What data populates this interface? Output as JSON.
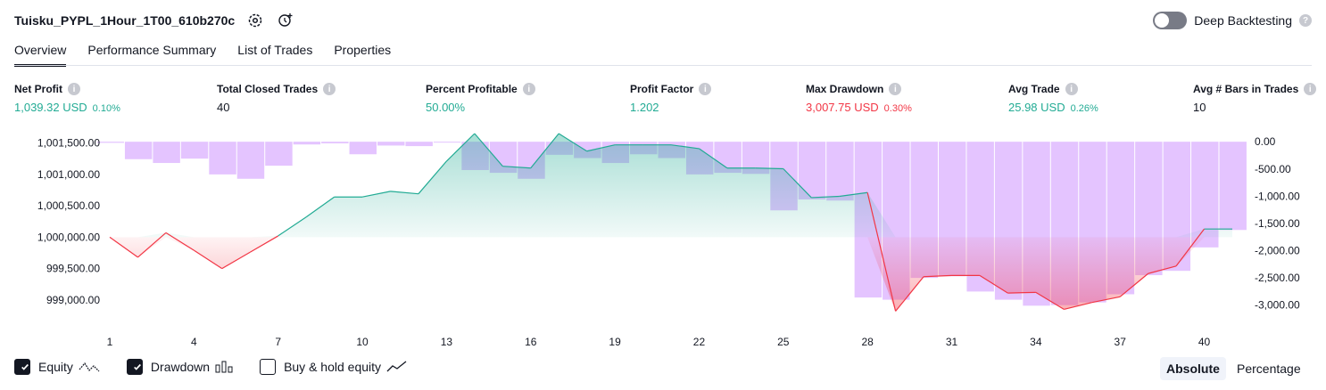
{
  "header": {
    "title": "Tuisku_PYPL_1Hour_1T00_610b270c",
    "deep_backtesting_label": "Deep Backtesting"
  },
  "tabs": [
    "Overview",
    "Performance Summary",
    "List of Trades",
    "Properties"
  ],
  "metrics": [
    {
      "label": "Net Profit",
      "value": "1,039.32 USD",
      "sub": "0.10%",
      "color": "#22ab94"
    },
    {
      "label": "Total Closed Trades",
      "value": "40",
      "sub": "",
      "color": "#131722"
    },
    {
      "label": "Percent Profitable",
      "value": "50.00%",
      "sub": "",
      "color": "#22ab94"
    },
    {
      "label": "Profit Factor",
      "value": "1.202",
      "sub": "",
      "color": "#22ab94"
    },
    {
      "label": "Max Drawdown",
      "value": "3,007.75 USD",
      "sub": "0.30%",
      "color": "#f23645"
    },
    {
      "label": "Avg Trade",
      "value": "25.98 USD",
      "sub": "0.26%",
      "color": "#22ab94"
    },
    {
      "label": "Avg # Bars in Trades",
      "value": "10",
      "sub": "",
      "color": "#131722"
    }
  ],
  "legend": {
    "equity": "Equity",
    "drawdown": "Drawdown",
    "buyhold": "Buy & hold equity"
  },
  "modes": {
    "absolute": "Absolute",
    "percentage": "Percentage"
  },
  "chart_data": {
    "type": "line",
    "x": [
      1,
      2,
      3,
      4,
      5,
      6,
      7,
      8,
      9,
      10,
      11,
      12,
      13,
      14,
      15,
      16,
      17,
      18,
      19,
      20,
      21,
      22,
      23,
      24,
      25,
      26,
      27,
      28,
      29,
      30,
      31,
      32,
      33,
      34,
      35,
      36,
      37,
      38,
      39,
      40,
      41
    ],
    "x_ticks": [
      "1",
      "4",
      "7",
      "10",
      "13",
      "16",
      "19",
      "22",
      "25",
      "28",
      "31",
      "34",
      "37",
      "40"
    ],
    "y_left_ticks": [
      "1,001,500.00",
      "1,001,000.00",
      "1,000,500.00",
      "1,000,000.00",
      "999,500.00",
      "999,000.00"
    ],
    "y_right_ticks": [
      "0.00",
      "-500.00",
      "-1,000.00",
      "-1,500.00",
      "-2,000.00",
      "-2,500.00",
      "-3,000.00"
    ],
    "ylim_left": [
      998700,
      1001650
    ],
    "ylim_right": [
      -3250,
      150
    ],
    "series": [
      {
        "name": "Equity",
        "values": [
          1000000,
          999680,
          1000070,
          999790,
          999500,
          999760,
          1000020,
          1000320,
          1000640,
          1000640,
          1000730,
          1000690,
          1001210,
          1001650,
          1001130,
          1001100,
          1001650,
          1001370,
          1001470,
          1001470,
          1001470,
          1001410,
          1001100,
          1001100,
          1001090,
          1000630,
          1000650,
          1000710,
          998820,
          999370,
          999390,
          999390,
          999110,
          999120,
          998850,
          998960,
          999050,
          999420,
          999540,
          1000130,
          1000130
        ],
        "color": "#22ab94"
      },
      {
        "name": "Drawdown",
        "values": [
          -20,
          -320,
          -390,
          -310,
          -600,
          -680,
          -440,
          -50,
          -30,
          -230,
          -70,
          -80,
          0,
          -520,
          -570,
          -680,
          -240,
          -300,
          -390,
          -230,
          -300,
          -600,
          -570,
          -590,
          -1260,
          -1060,
          -1080,
          -2860,
          -2900,
          -2500,
          -2470,
          -2750,
          -2900,
          -3010,
          -3000,
          -2950,
          -2800,
          -2450,
          -2370,
          -1940,
          -1620
        ],
        "color": "#b388ff"
      }
    ],
    "x_equity": [
      1,
      2,
      3,
      4,
      5,
      6,
      7,
      8,
      9,
      10,
      11,
      12,
      13,
      14,
      15,
      16,
      17,
      18,
      19,
      20,
      21,
      22,
      23,
      24,
      25,
      26,
      27,
      28,
      29,
      30,
      31,
      32,
      33,
      34,
      35,
      36,
      37,
      38,
      39,
      40,
      41
    ],
    "legend_position": "bottom-left"
  }
}
